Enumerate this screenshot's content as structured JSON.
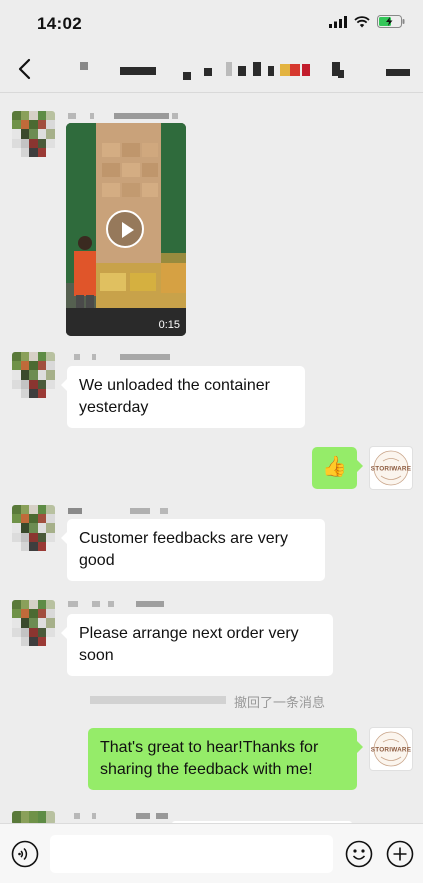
{
  "status_bar": {
    "time": "14:02"
  },
  "messages": [
    {
      "type": "video",
      "side": "left",
      "duration": "0:15"
    },
    {
      "type": "text",
      "side": "left",
      "text": "We unloaded the container yesterday"
    },
    {
      "type": "emoji",
      "side": "right",
      "emoji": "👍"
    },
    {
      "type": "text",
      "side": "left",
      "text": "Customer feedbacks are very good"
    },
    {
      "type": "text",
      "side": "left",
      "text": "Please arrange next order very soon"
    },
    {
      "type": "system",
      "text": "撤回了一条消息"
    },
    {
      "type": "text",
      "side": "right",
      "text": "That's great to hear!Thanks for sharing the feedback with me!"
    }
  ],
  "my_avatar_logo": "STORIWARE",
  "colors": {
    "background": "#ededed",
    "bubble_left": "#ffffff",
    "bubble_right": "#95ec69",
    "accent": "#95ec69"
  },
  "icons": {
    "back": "chevron-left-icon",
    "voice": "voice-icon",
    "emoji": "emoji-icon",
    "plus": "plus-icon",
    "play": "play-icon"
  }
}
